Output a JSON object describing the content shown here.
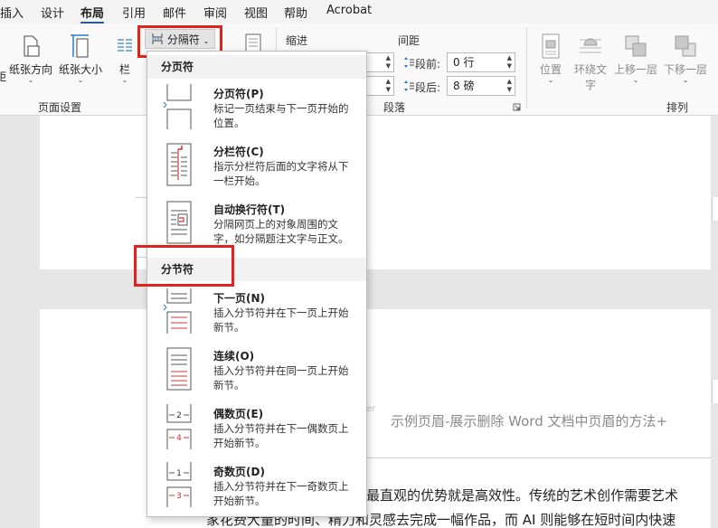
{
  "menu": {
    "tabs": [
      "插入",
      "设计",
      "布局",
      "引用",
      "邮件",
      "审阅",
      "视图",
      "帮助",
      "Acrobat"
    ],
    "active": "布局"
  },
  "ribbon": {
    "margins_label": "距",
    "orientation_label": "纸张方向",
    "size_label": "纸张大小",
    "columns_label": "栏",
    "breaks_label": "分隔符",
    "page_setup_group": "页面设置",
    "indent_label": "缩进",
    "spacing_label": "间距",
    "before_label": "段前:",
    "before_value": "0 行",
    "after_label": "段后:",
    "after_value": "8 磅",
    "paragraph_group": "段落",
    "position_label": "位置",
    "wrap_text_label": "环绕文字",
    "wrap_text_line1": "环绕文",
    "wrap_text_line2": "字",
    "bring_forward_label": "上移一层",
    "send_backward_label": "下移一层",
    "arrange_group": "排列"
  },
  "dropdown": {
    "page_breaks_header": "分页符",
    "section_breaks_header": "分节符",
    "page_items": [
      {
        "title": "分页符(P)",
        "desc_line1": "标记一页结束与下一页开始的",
        "desc_line2": "位置。",
        "icon": "page-break-icon"
      },
      {
        "title": "分栏符(C)",
        "desc_line1": "指示分栏符后面的文字将从下",
        "desc_line2": "一栏开始。",
        "icon": "column-break-icon"
      },
      {
        "title": "自动换行符(T)",
        "desc_line1": "分隔网页上的对象周围的文",
        "desc_line2": "字，如分隔题注文字与正文。",
        "icon": "text-wrapping-icon"
      }
    ],
    "section_items": [
      {
        "title": "下一页(N)",
        "desc_line1": "插入分节符并在下一页上开始",
        "desc_line2": "新节。",
        "icon": "next-page-icon"
      },
      {
        "title": "连续(O)",
        "desc_line1": "插入分节符并在同一页上开始",
        "desc_line2": "新节。",
        "icon": "continuous-icon"
      },
      {
        "title": "偶数页(E)",
        "desc_line1": "插入分节符并在下一偶数页上",
        "desc_line2": "开始新节。",
        "icon": "even-page-icon"
      },
      {
        "title": "奇数页(D)",
        "desc_line1": "插入分节符并在下一奇数页上",
        "desc_line2": "开始新节。",
        "icon": "odd-page-icon"
      }
    ]
  },
  "document": {
    "header_tag": "er",
    "header_text": "示例页眉-展示删除 Word 文档中页眉的方法",
    "header_cursor": "+",
    "body_line1": "最直观的优势就是高效性。传统的艺术创作需要艺术",
    "body_line2": "家花费大量的时间、精力和灵感去完成一幅作品，而 AI 则能够在短时间内快速"
  },
  "colors": {
    "accent": "#2b579a",
    "highlight": "#e0241b",
    "break_red": "#d13438"
  }
}
